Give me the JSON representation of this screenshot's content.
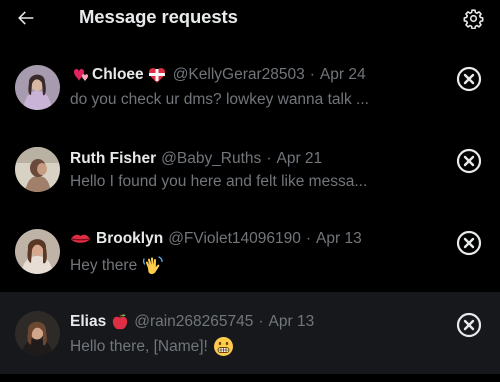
{
  "header": {
    "title": "Message requests"
  },
  "requests": [
    {
      "name": "Chloee",
      "handle": "@KellyGerar28503",
      "separator": "·",
      "date": "Apr 24",
      "message": "do you check ur dms? lowkey wanna talk ..."
    },
    {
      "name": "Ruth Fisher",
      "handle": "@Baby_Ruths",
      "separator": "·",
      "date": "Apr 21",
      "message": "Hello I found you here and felt like messa..."
    },
    {
      "name": "Brooklyn",
      "handle": "@FViolet14096190",
      "separator": "·",
      "date": "Apr 13",
      "message": "Hey there"
    },
    {
      "name": "Elias",
      "handle": "@rain268265745",
      "separator": "·",
      "date": "Apr 13",
      "message": "Hello there, [Name]!"
    }
  ],
  "colors": {
    "background": "#000000",
    "hover_row": "#16181c",
    "primary_text": "#e7e9ea",
    "secondary_text": "#71767b"
  },
  "icons": {
    "back": "arrow-left-icon",
    "settings": "gear-icon",
    "dismiss": "close-circle-icon"
  }
}
